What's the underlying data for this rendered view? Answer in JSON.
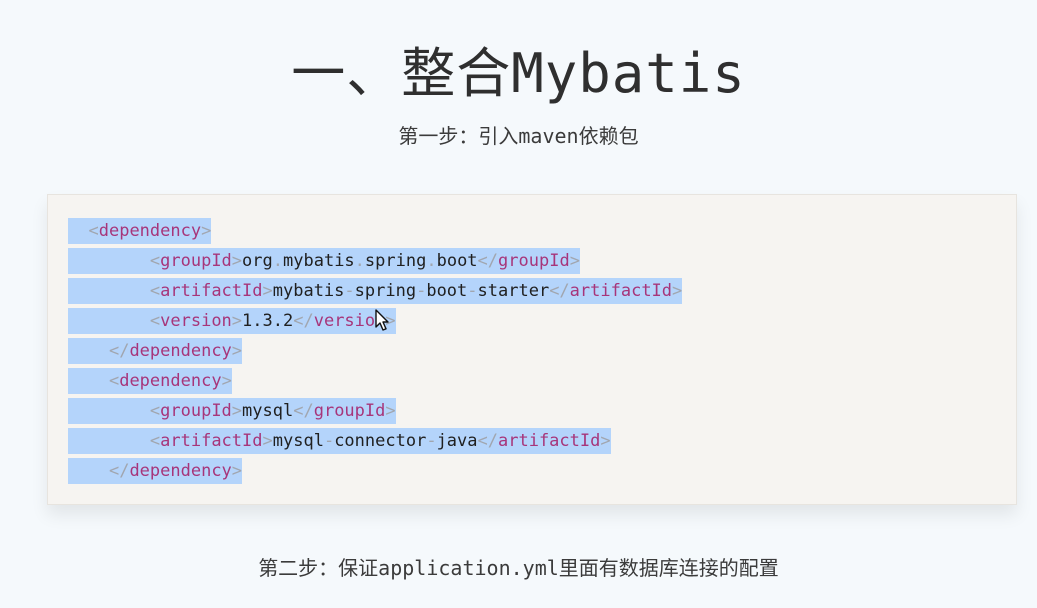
{
  "heading": {
    "title": "一、整合Mybatis",
    "step1": "第一步：引入maven依赖包",
    "step2": "第二步：保证application.yml里面有数据库连接的配置"
  },
  "code": {
    "line1": {
      "tag": "dependency"
    },
    "line2": {
      "tag": "groupId",
      "parts": [
        "org",
        ".",
        "mybatis",
        ".",
        "spring",
        ".",
        "boot"
      ]
    },
    "line3": {
      "tag": "artifactId",
      "parts": [
        "mybatis",
        "-",
        "spring",
        "-",
        "boot",
        "-",
        "starter"
      ]
    },
    "line4": {
      "tag": "version",
      "value": "1.3.2"
    },
    "line5": {
      "tag": "dependency"
    },
    "line6": {
      "tag": "dependency"
    },
    "line7": {
      "tag": "groupId",
      "value": "mysql"
    },
    "line8": {
      "tag": "artifactId",
      "parts": [
        "mysql",
        "-",
        "connector",
        "-",
        "java"
      ]
    },
    "line9": {
      "tag": "dependency"
    }
  },
  "symbols": {
    "lt": "<",
    "gt": ">",
    "close": "</"
  },
  "icons": {
    "cursor": "mouse-pointer-icon"
  },
  "colors": {
    "background": "#f5f9fc",
    "selection": "#b4d4fb",
    "tag": "#a7357a",
    "punctuation": "#a1a6af",
    "text": "#202020"
  }
}
